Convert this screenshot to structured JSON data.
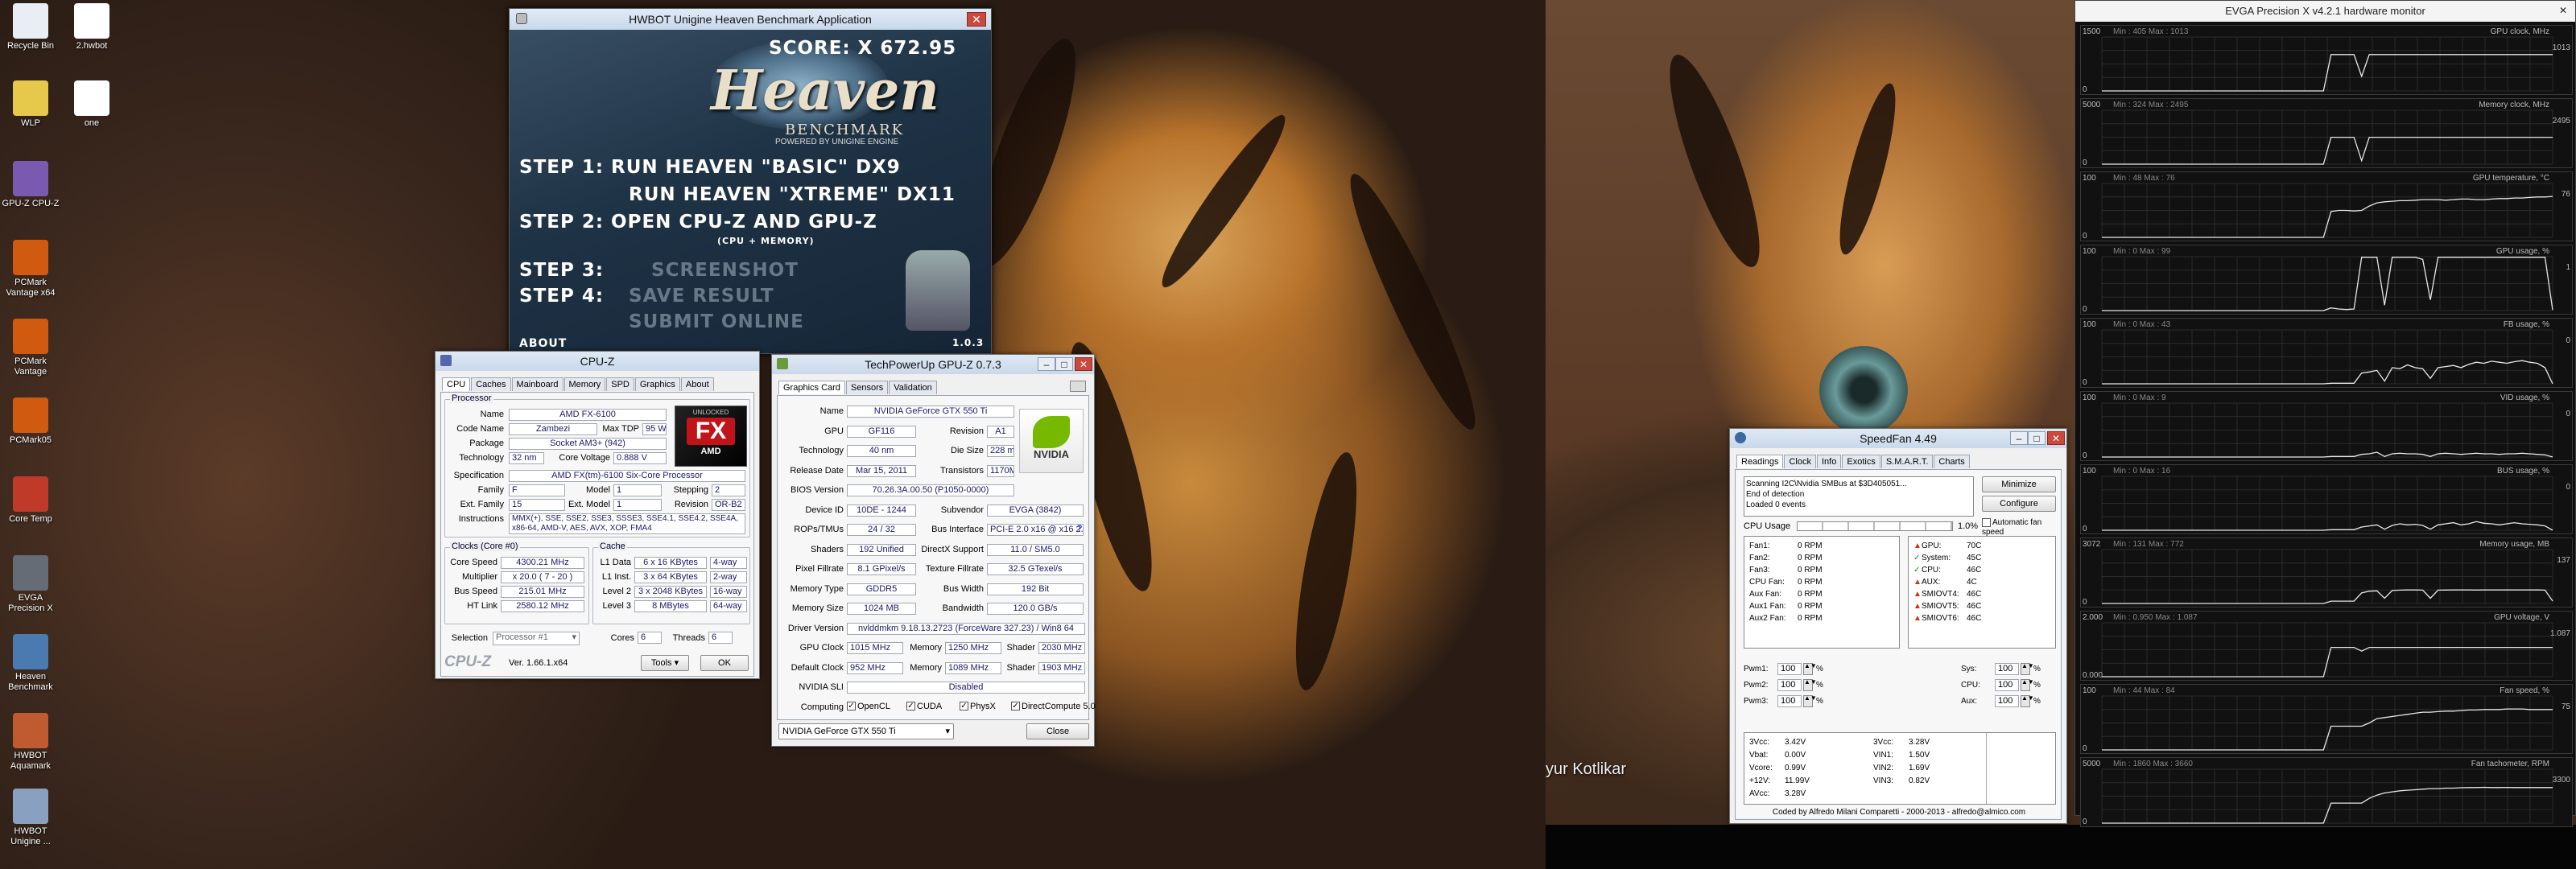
{
  "desktop": {
    "icons": [
      {
        "name": "Recycle Bin"
      },
      {
        "name": "2.hwbot"
      },
      {
        "name": "WLP"
      },
      {
        "name": "one"
      },
      {
        "name": "GPU-Z CPU-Z"
      },
      {
        "name": "PCMark Vantage x64"
      },
      {
        "name": "PCMark Vantage"
      },
      {
        "name": "PCMark05"
      },
      {
        "name": "Core Temp"
      },
      {
        "name": "EVGA Precision X"
      },
      {
        "name": "Heaven Benchmark"
      },
      {
        "name": "HWBOT Aquamark"
      },
      {
        "name": "HWBOT Unigine ..."
      }
    ],
    "wallpaper_credit": "yur Kotlikar"
  },
  "heaven": {
    "title": "HWBOT Unigine Heaven Benchmark Application",
    "score": "SCORE: X 672.95",
    "logo": "Heaven",
    "logo_sub": "BENCHMARK",
    "powered": "POWERED BY UNIGINE ENGINE",
    "step1": "STEP 1:  RUN HEAVEN \"BASIC\" DX9",
    "step1b": "RUN HEAVEN \"XTREME\" DX11",
    "step2": "STEP 2: OPEN CPU-Z  AND  GPU-Z",
    "step2sub": "(CPU + MEMORY)",
    "step3": "STEP 3:",
    "step3b": "SCREENSHOT",
    "step4": "STEP 4:",
    "step4b": "SAVE RESULT",
    "step5": "SUBMIT ONLINE",
    "about": "ABOUT",
    "version": "1.0.3"
  },
  "cpuz": {
    "title": "CPU-Z",
    "tabs": [
      "CPU",
      "Caches",
      "Mainboard",
      "Memory",
      "SPD",
      "Graphics",
      "About"
    ],
    "processor_label": "Processor",
    "name_l": "Name",
    "name": "AMD FX-6100",
    "code_l": "Code Name",
    "code": "Zambezi",
    "tdp_l": "Max TDP",
    "tdp": "95 W",
    "pkg_l": "Package",
    "pkg": "Socket AM3+ (942)",
    "tech_l": "Technology",
    "tech": "32 nm",
    "volt_l": "Core Voltage",
    "volt": "0.888 V",
    "spec_l": "Specification",
    "spec": "AMD FX(tm)-6100 Six-Core Processor",
    "fam_l": "Family",
    "fam": "F",
    "model_l": "Model",
    "model": "1",
    "step_l": "Stepping",
    "step": "2",
    "efam_l": "Ext. Family",
    "efam": "15",
    "emod_l": "Ext. Model",
    "emod": "1",
    "rev_l": "Revision",
    "rev": "OR-B2",
    "instr_l": "Instructions",
    "instr": "MMX(+), SSE, SSE2, SSE3, SSSE3, SSE4.1, SSE4.2, SSE4A, x86-64, AMD-V, AES, AVX, XOP, FMA4",
    "clocks_l": "Clocks (Core #0)",
    "cache_l": "Cache",
    "cs_l": "Core Speed",
    "cs": "4300.21 MHz",
    "mul_l": "Multiplier",
    "mul": "x 20.0 ( 7 - 20 )",
    "bus_l": "Bus Speed",
    "bus": "215.01 MHz",
    "ht_l": "HT Link",
    "ht": "2580.12 MHz",
    "l1d_l": "L1 Data",
    "l1d": "6 x 16 KBytes",
    "l1d_w": "4-way",
    "l1i_l": "L1 Inst.",
    "l1i": "3 x 64 KBytes",
    "l1i_w": "2-way",
    "l2_l": "Level 2",
    "l2": "3 x 2048 KBytes",
    "l2_w": "16-way",
    "l3_l": "Level 3",
    "l3": "8 MBytes",
    "l3_w": "64-way",
    "sel_l": "Selection",
    "sel": "Processor #1",
    "cores_l": "Cores",
    "cores": "6",
    "thr_l": "Threads",
    "thr": "6",
    "brand": "CPU-Z",
    "ver": "Ver. 1.66.1.x64",
    "tools": "Tools",
    "ok": "OK",
    "badge_top": "UNLOCKED",
    "badge_fx": "FX",
    "badge_amd": "AMD"
  },
  "gpuz": {
    "title": "TechPowerUp GPU-Z 0.7.3",
    "tabs": [
      "Graphics Card",
      "Sensors",
      "Validation"
    ],
    "rows": [
      {
        "l": "Name",
        "v": "NVIDIA GeForce GTX 550 Ti"
      },
      {
        "l": "GPU",
        "v": "GF116",
        "l2": "Revision",
        "v2": "A1"
      },
      {
        "l": "Technology",
        "v": "40 nm",
        "l2": "Die Size",
        "v2": "228 mm²"
      },
      {
        "l": "Release Date",
        "v": "Mar 15, 2011",
        "l2": "Transistors",
        "v2": "1170M"
      },
      {
        "l": "BIOS Version",
        "v": "70.26.3A.00.50 (P1050-0000)"
      },
      {
        "l": "Device ID",
        "v": "10DE - 1244",
        "l2": "Subvendor",
        "v2": "EVGA (3842)"
      },
      {
        "l": "ROPs/TMUs",
        "v": "24 / 32",
        "l2": "Bus Interface",
        "v2": "PCI-E 2.0 x16 @ x16 2.0"
      },
      {
        "l": "Shaders",
        "v": "192 Unified",
        "l2": "DirectX Support",
        "v2": "11.0 / SM5.0"
      },
      {
        "l": "Pixel Fillrate",
        "v": "8.1 GPixel/s",
        "l2": "Texture Fillrate",
        "v2": "32.5 GTexel/s"
      },
      {
        "l": "Memory Type",
        "v": "GDDR5",
        "l2": "Bus Width",
        "v2": "192 Bit"
      },
      {
        "l": "Memory Size",
        "v": "1024 MB",
        "l2": "Bandwidth",
        "v2": "120.0 GB/s"
      },
      {
        "l": "Driver Version",
        "v": "nvlddmkm 9.18.13.2723 (ForceWare 327.23) / Win8 64"
      }
    ],
    "gpuclock_l": "GPU Clock",
    "gpuclock": "1015 MHz",
    "mem_l": "Memory",
    "mem": "1250 MHz",
    "sh_l": "Shader",
    "sh": "2030 MHz",
    "defclock_l": "Default Clock",
    "defclock": "952 MHz",
    "dmem": "1089 MHz",
    "dsh": "1903 MHz",
    "sli_l": "NVIDIA SLI",
    "sli": "Disabled",
    "comp_l": "Computing",
    "opencl": "OpenCL",
    "cuda": "CUDA",
    "physx": "PhysX",
    "dc": "DirectCompute 5.0",
    "select": "NVIDIA GeForce GTX 550 Ti",
    "close": "Close",
    "nvidia": "NVIDIA",
    "help": "?"
  },
  "speedfan": {
    "title": "SpeedFan 4.49",
    "tabs": [
      "Readings",
      "Clock",
      "Info",
      "Exotics",
      "S.M.A.R.T.",
      "Charts"
    ],
    "log": [
      "Scanning I2C\\Nvidia SMBus at $3D405051...",
      "End of detection",
      "Loaded 0 events"
    ],
    "minimize": "Minimize",
    "configure": "Configure",
    "cpu_usage_l": "CPU Usage",
    "cpu_usage": "1.0%",
    "auto": "Automatic fan speed",
    "fans": [
      "Fan1:",
      "Fan2:",
      "Fan3:",
      "CPU Fan:",
      "Aux Fan:",
      "Aux1 Fan:",
      "Aux2 Fan:"
    ],
    "rpm": "0 RPM",
    "temps": [
      {
        "l": "GPU:",
        "v": "70C"
      },
      {
        "l": "System:",
        "v": "45C"
      },
      {
        "l": "CPU:",
        "v": "46C"
      },
      {
        "l": "AUX:",
        "v": "4C"
      },
      {
        "l": "SMIOVT4:",
        "v": "46C"
      },
      {
        "l": "SMIOVT5:",
        "v": "46C"
      },
      {
        "l": "SMIOVT6:",
        "v": "46C"
      }
    ],
    "pwm": [
      {
        "l": "Pwm1:",
        "v": "100"
      },
      {
        "l": "Pwm2:",
        "v": "100"
      },
      {
        "l": "Pwm3:",
        "v": "100"
      }
    ],
    "pwm2": [
      {
        "l": "Sys:",
        "v": "100"
      },
      {
        "l": "CPU:",
        "v": "100"
      },
      {
        "l": "Aux:",
        "v": "100"
      }
    ],
    "pct": "%",
    "volts1": [
      {
        "l": "3Vcc:",
        "v": "3.42V"
      },
      {
        "l": "Vbat:",
        "v": "0.00V"
      },
      {
        "l": "Vcore:",
        "v": "0.99V"
      },
      {
        "l": "+12V:",
        "v": "11.99V"
      },
      {
        "l": "AVcc:",
        "v": "3.28V"
      }
    ],
    "volts2": [
      {
        "l": "3Vcc:",
        "v": "3.28V"
      },
      {
        "l": "VIN1:",
        "v": "1.50V"
      },
      {
        "l": "VIN2:",
        "v": "1.69V"
      },
      {
        "l": "VIN3:",
        "v": "0.82V"
      }
    ],
    "footer": "Coded by Alfredo Milani Comparetti - 2000-2013 - alfredo@almico.com"
  },
  "evga": {
    "title": "EVGA Precision X v4.2.1 hardware monitor",
    "colors": {
      "line": "#e8e8e8",
      "grid": "#2c2c2c",
      "text": "#bdbdbd"
    },
    "panels": [
      {
        "name": "GPU clock, MHz",
        "stats": "Min : 405  Max : 1013",
        "ytop": "1500",
        "ybot": "0",
        "cur": "1013",
        "vals": [
          0,
          0,
          0,
          0,
          0,
          0,
          0,
          0,
          0,
          0,
          0,
          0,
          0,
          0,
          0,
          0,
          0,
          0,
          0,
          0,
          0,
          0,
          0,
          0,
          0,
          0,
          0,
          0,
          0,
          0,
          1013,
          1013,
          1013,
          1013,
          405,
          1013,
          1013,
          1013,
          1013,
          1013,
          1013,
          1013,
          1013,
          1013,
          1013,
          1013,
          1013,
          1013,
          1013,
          1013,
          1013,
          1013,
          1013,
          1013,
          1013,
          1013,
          1013,
          1013,
          1013,
          1013
        ],
        "max": 1500
      },
      {
        "name": "Memory clock, MHz",
        "stats": "Min : 324  Max : 2495",
        "ytop": "5000",
        "ybot": "0",
        "cur": "2495",
        "vals": [
          0,
          0,
          0,
          0,
          0,
          0,
          0,
          0,
          0,
          0,
          0,
          0,
          0,
          0,
          0,
          0,
          0,
          0,
          0,
          0,
          0,
          0,
          0,
          0,
          0,
          0,
          0,
          0,
          0,
          0,
          2495,
          2495,
          2495,
          2495,
          324,
          2495,
          2495,
          2495,
          2495,
          2495,
          2495,
          2495,
          2495,
          2495,
          2495,
          2495,
          2495,
          2495,
          2495,
          2495,
          2495,
          2495,
          2495,
          2495,
          2495,
          2495,
          2495,
          2495,
          2495,
          2495
        ],
        "max": 5000
      },
      {
        "name": "GPU temperature, °C",
        "stats": "Min : 48  Max : 76",
        "ytop": "100",
        "ybot": "0",
        "cur": "76",
        "vals": [
          0,
          0,
          0,
          0,
          0,
          0,
          0,
          0,
          0,
          0,
          0,
          0,
          0,
          0,
          0,
          0,
          0,
          0,
          0,
          0,
          0,
          0,
          0,
          0,
          0,
          0,
          0,
          0,
          0,
          0,
          48,
          50,
          50,
          49,
          50,
          58,
          64,
          66,
          67,
          68,
          68,
          69,
          70,
          70,
          70,
          69,
          70,
          71,
          71,
          70,
          70,
          71,
          72,
          72,
          73,
          73,
          74,
          75,
          75,
          76
        ],
        "max": 100
      },
      {
        "name": "GPU usage, %",
        "stats": "Min : 0  Max : 99",
        "ytop": "100",
        "ybot": "0",
        "cur": "1",
        "vals": [
          0,
          0,
          0,
          0,
          0,
          0,
          0,
          0,
          0,
          0,
          0,
          0,
          0,
          0,
          0,
          0,
          0,
          0,
          0,
          0,
          0,
          0,
          0,
          0,
          0,
          0,
          0,
          0,
          0,
          0,
          5,
          3,
          2,
          3,
          99,
          99,
          99,
          10,
          99,
          99,
          99,
          99,
          95,
          20,
          99,
          99,
          99,
          99,
          99,
          99,
          99,
          99,
          99,
          99,
          99,
          99,
          99,
          99,
          99,
          1
        ],
        "max": 100
      },
      {
        "name": "FB usage, %",
        "stats": "Min : 0  Max : 43",
        "ytop": "100",
        "ybot": "0",
        "cur": "0",
        "vals": [
          0,
          0,
          0,
          0,
          0,
          0,
          0,
          0,
          0,
          0,
          0,
          0,
          0,
          0,
          0,
          0,
          0,
          0,
          0,
          0,
          0,
          0,
          0,
          0,
          0,
          0,
          0,
          0,
          0,
          0,
          1,
          1,
          1,
          1,
          20,
          22,
          25,
          5,
          30,
          28,
          35,
          30,
          28,
          10,
          30,
          32,
          34,
          30,
          36,
          40,
          38,
          42,
          40,
          38,
          41,
          43,
          40,
          38,
          30,
          0
        ],
        "max": 100
      },
      {
        "name": "VID usage, %",
        "stats": "Min : 0  Max : 9",
        "ytop": "100",
        "ybot": "0",
        "cur": "0",
        "vals": [
          0,
          0,
          0,
          0,
          0,
          0,
          0,
          0,
          0,
          0,
          0,
          0,
          0,
          0,
          0,
          0,
          0,
          0,
          0,
          0,
          0,
          0,
          0,
          0,
          0,
          0,
          0,
          0,
          0,
          0,
          1,
          1,
          1,
          1,
          5,
          6,
          9,
          1,
          6,
          7,
          6,
          6,
          5,
          1,
          6,
          7,
          6,
          5,
          6,
          7,
          6,
          6,
          5,
          6,
          6,
          7,
          6,
          5,
          4,
          0
        ],
        "max": 100
      },
      {
        "name": "BUS usage, %",
        "stats": "Min : 0  Max : 16",
        "ytop": "100",
        "ybot": "0",
        "cur": "0",
        "vals": [
          0,
          0,
          0,
          0,
          0,
          0,
          0,
          0,
          0,
          0,
          0,
          0,
          0,
          0,
          0,
          0,
          0,
          0,
          0,
          0,
          0,
          0,
          0,
          0,
          0,
          0,
          0,
          0,
          0,
          0,
          1,
          1,
          1,
          1,
          6,
          8,
          10,
          2,
          9,
          12,
          10,
          11,
          9,
          2,
          10,
          12,
          14,
          10,
          12,
          16,
          13,
          12,
          10,
          12,
          14,
          12,
          11,
          10,
          8,
          0
        ],
        "max": 100
      },
      {
        "name": "Memory usage, MB",
        "stats": "Min : 131  Max : 772",
        "ytop": "3072",
        "ybot": "0",
        "cur": "137",
        "vals": [
          0,
          0,
          0,
          0,
          0,
          0,
          0,
          0,
          0,
          0,
          0,
          0,
          0,
          0,
          0,
          0,
          0,
          0,
          0,
          0,
          0,
          0,
          0,
          0,
          0,
          0,
          0,
          0,
          0,
          0,
          131,
          131,
          131,
          131,
          600,
          700,
          720,
          300,
          740,
          760,
          770,
          772,
          760,
          300,
          760,
          765,
          770,
          772,
          770,
          768,
          770,
          772,
          770,
          771,
          772,
          770,
          769,
          770,
          760,
          137
        ],
        "max": 3072
      },
      {
        "name": "GPU voltage, V",
        "stats": "Min : 0.950  Max : 1.087",
        "ytop": "2.000",
        "ybot": "0.000",
        "cur": "1.087",
        "vals": [
          0,
          0,
          0,
          0,
          0,
          0,
          0,
          0,
          0,
          0,
          0,
          0,
          0,
          0,
          0,
          0,
          0,
          0,
          0,
          0,
          0,
          0,
          0,
          0,
          0,
          0,
          0,
          0,
          0,
          0,
          1.087,
          1.087,
          1.087,
          1.087,
          0.95,
          1.087,
          1.087,
          1.087,
          1.087,
          1.087,
          1.087,
          1.087,
          1.087,
          1.087,
          1.087,
          1.087,
          1.087,
          1.087,
          1.087,
          1.087,
          1.087,
          1.087,
          1.087,
          1.087,
          1.087,
          1.087,
          1.087,
          1.087,
          1.087,
          1.087
        ],
        "max": 2
      },
      {
        "name": "Fan speed, %",
        "stats": "Min : 44  Max : 84",
        "ytop": "100",
        "ybot": "0",
        "cur": "75",
        "vals": [
          0,
          0,
          0,
          0,
          0,
          0,
          0,
          0,
          0,
          0,
          0,
          0,
          0,
          0,
          0,
          0,
          0,
          0,
          0,
          0,
          0,
          0,
          0,
          0,
          0,
          0,
          0,
          0,
          0,
          0,
          44,
          44,
          44,
          44,
          44,
          50,
          58,
          60,
          62,
          64,
          66,
          68,
          70,
          70,
          71,
          72,
          72,
          73,
          74,
          74,
          75,
          75,
          75,
          76,
          76,
          76,
          75,
          75,
          75,
          75
        ],
        "max": 100
      },
      {
        "name": "Fan tachometer, RPM",
        "stats": "Min : 1860  Max : 3660",
        "ytop": "5000",
        "ybot": "0",
        "cur": "3300",
        "vals": [
          0,
          0,
          0,
          0,
          0,
          0,
          0,
          0,
          0,
          0,
          0,
          0,
          0,
          0,
          0,
          0,
          0,
          0,
          0,
          0,
          0,
          0,
          0,
          0,
          0,
          0,
          0,
          0,
          0,
          0,
          1860,
          1860,
          1860,
          1860,
          1860,
          2300,
          2600,
          2800,
          2900,
          3000,
          3050,
          3100,
          3150,
          3200,
          3200,
          3250,
          3250,
          3280,
          3300,
          3300,
          3320,
          3300,
          3300,
          3310,
          3300,
          3300,
          3300,
          3300,
          3300,
          3300
        ],
        "max": 5000
      }
    ]
  }
}
